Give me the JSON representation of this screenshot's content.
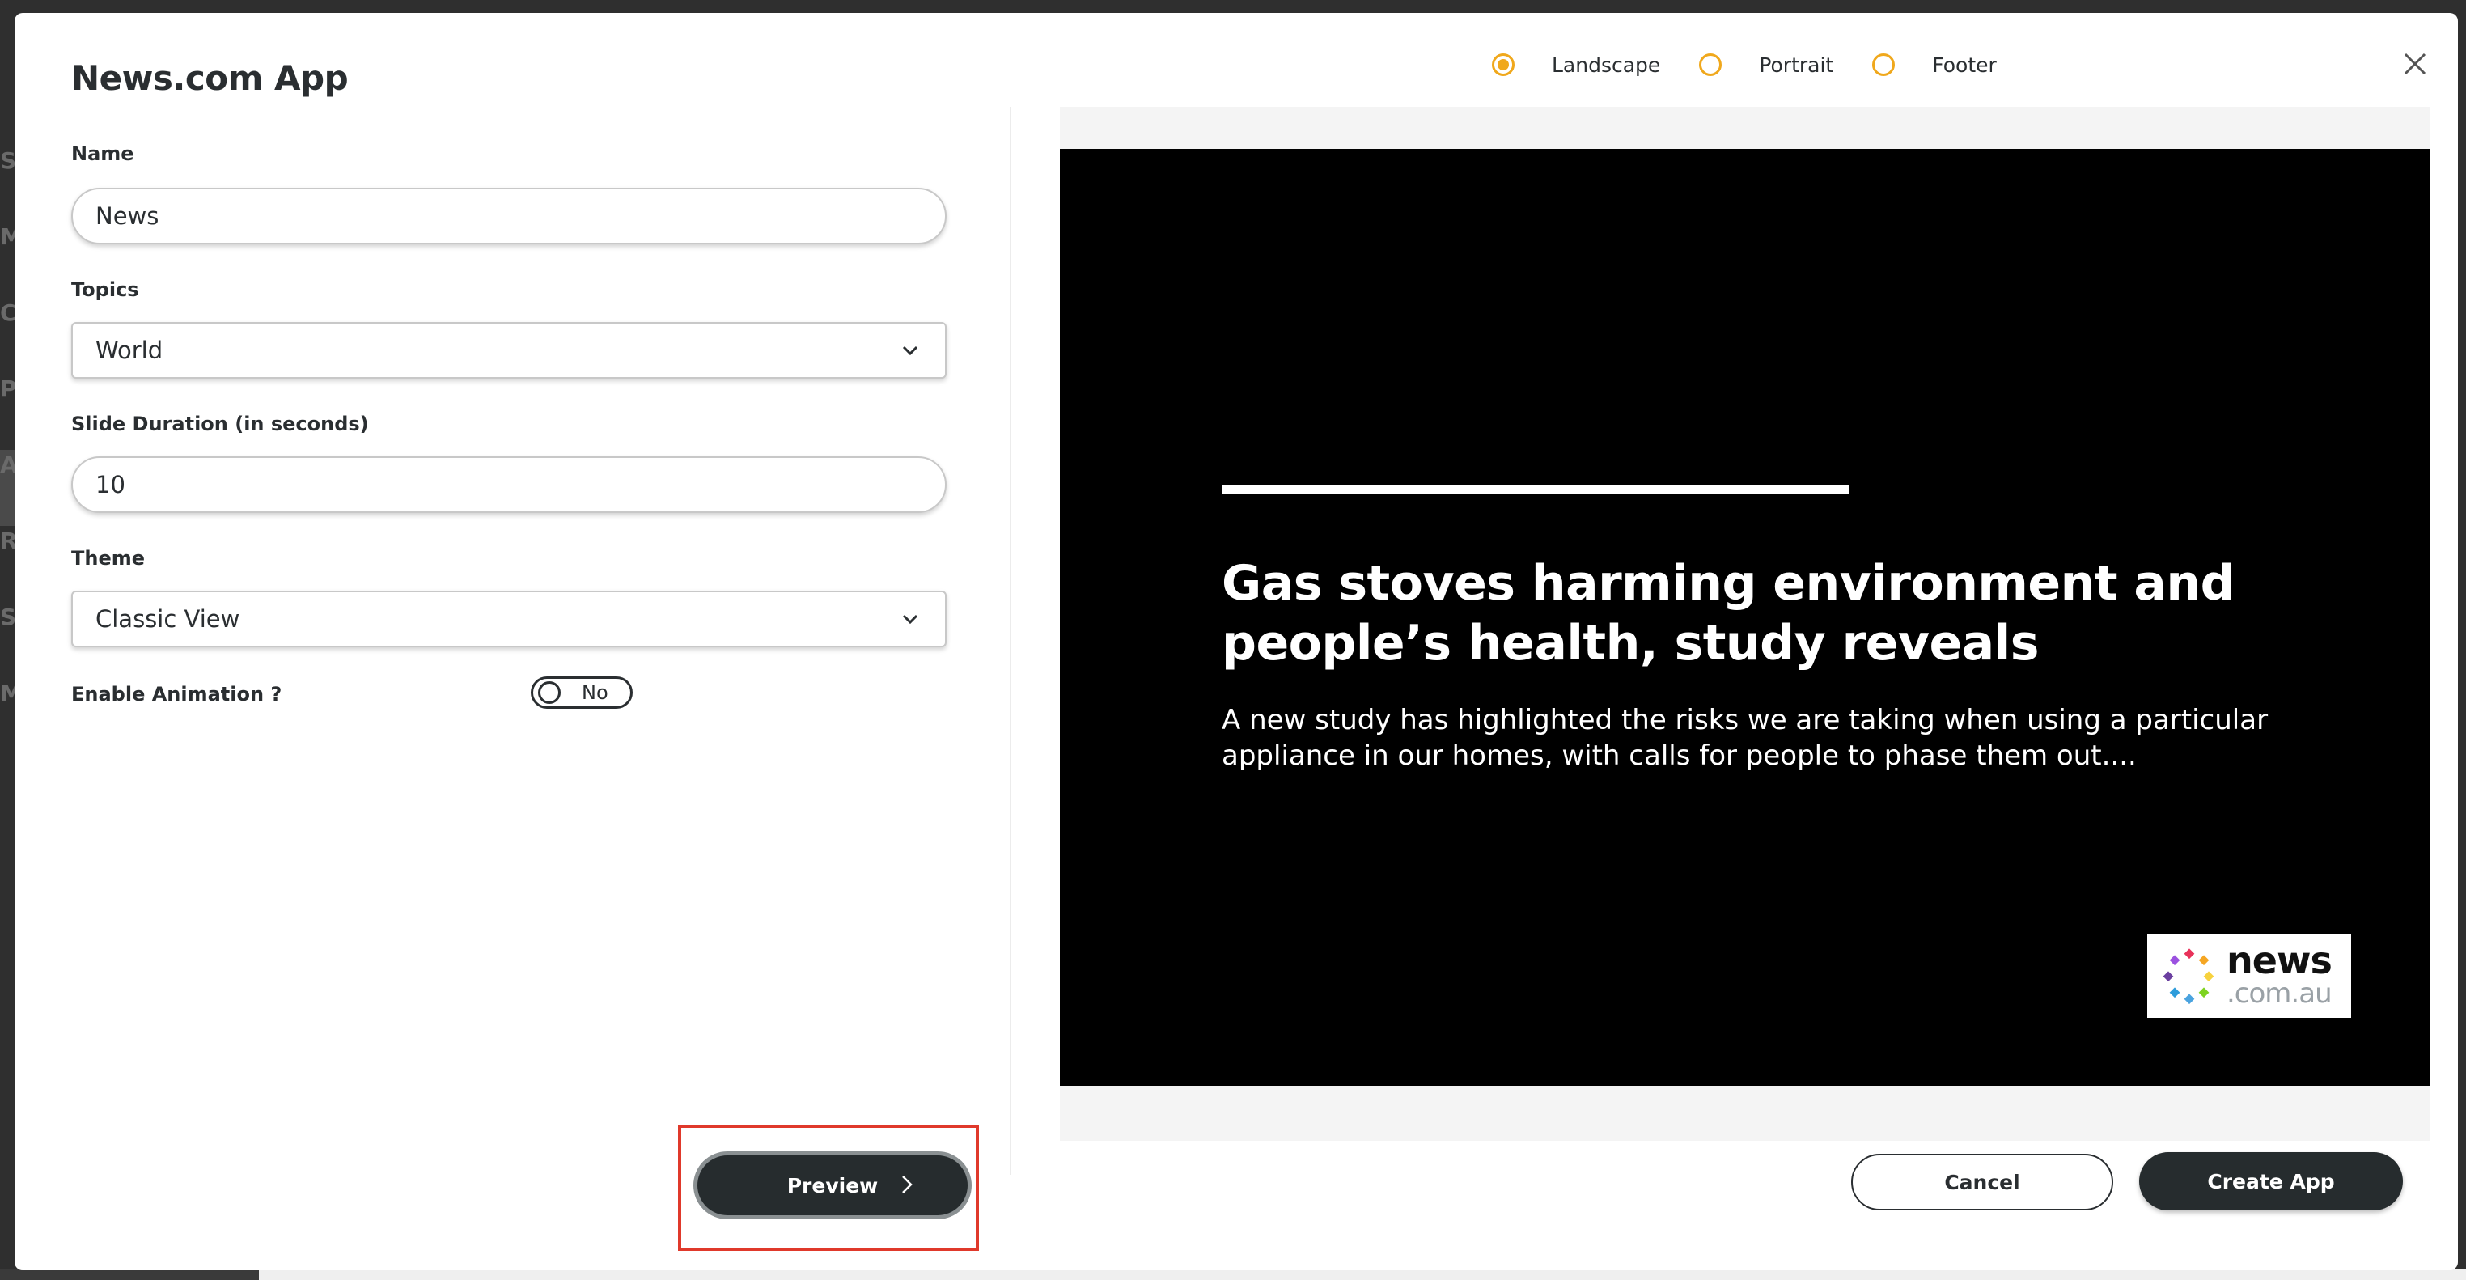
{
  "background": {
    "sidebar_letters": [
      "S",
      "M",
      "C",
      "P",
      "A",
      "R",
      "S",
      "M"
    ]
  },
  "modal": {
    "title": "News.com App",
    "orientation": {
      "options": [
        {
          "label": "Landscape",
          "selected": true
        },
        {
          "label": "Portrait",
          "selected": false
        },
        {
          "label": "Footer",
          "selected": false
        }
      ],
      "accent_color": "#f0a81c"
    },
    "close_icon": "close-icon"
  },
  "form": {
    "name": {
      "label": "Name",
      "value": "News"
    },
    "topics": {
      "label": "Topics",
      "value": "World"
    },
    "slide_duration": {
      "label": "Slide Duration (in seconds)",
      "value": "10"
    },
    "theme": {
      "label": "Theme",
      "value": "Classic View"
    },
    "animation": {
      "label": "Enable Animation ?",
      "value": "No",
      "enabled": false
    }
  },
  "actions": {
    "preview_label": "Preview",
    "cancel_label": "Cancel",
    "create_label": "Create App",
    "primary_color": "#262c2e",
    "highlight_color": "#e0392b"
  },
  "preview": {
    "headline": "Gas stoves harming environment and people’s health, study reveals",
    "summary": "A new study has highlighted the risks we are taking when using a particular appliance in our homes, with calls for people to phase them out....",
    "logo_top": "news",
    "logo_bottom": ".com.au"
  }
}
